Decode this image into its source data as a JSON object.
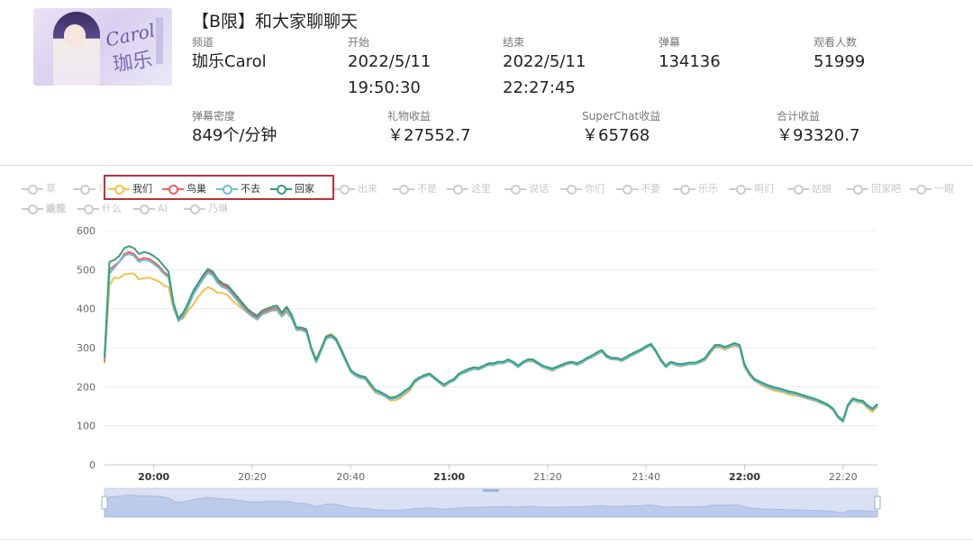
{
  "stream": {
    "title": "【B限】和大家聊聊天",
    "thumbnail": {
      "sig_latin": "Carol",
      "sig_cjk": "珈乐"
    },
    "fields_row1": [
      {
        "label": "频道",
        "value": "珈乐Carol"
      },
      {
        "label": "开始",
        "value": "2022/5/11",
        "value2": "19:50:30"
      },
      {
        "label": "结束",
        "value": "2022/5/11",
        "value2": "22:27:45"
      },
      {
        "label": "弹幕",
        "value": "134136"
      },
      {
        "label": "观看人数",
        "value": "51999"
      }
    ],
    "fields_row2": [
      {
        "label": "弹幕密度",
        "value": "849个/分钟"
      },
      {
        "label": "礼物收益",
        "value": "￥27552.7"
      },
      {
        "label": "SuperChat收益",
        "value": "￥65768"
      },
      {
        "label": "合计收益",
        "value": "￥93320.7"
      }
    ]
  },
  "legend": [
    {
      "name": "草",
      "on": false
    },
    {
      "name": "？",
      "on": false
    },
    {
      "name": "我们",
      "on": true
    },
    {
      "name": "鸟巢",
      "on": true
    },
    {
      "name": "不去",
      "on": true
    },
    {
      "name": "回家",
      "on": true
    },
    {
      "name": "出来",
      "on": false
    },
    {
      "name": "不是",
      "on": false
    },
    {
      "name": "这里",
      "on": false
    },
    {
      "name": "说话",
      "on": false
    },
    {
      "name": "你们",
      "on": false
    },
    {
      "name": "不要",
      "on": false
    },
    {
      "name": "乐乐",
      "on": false
    },
    {
      "name": "啊们",
      "on": false
    },
    {
      "name": "姑娘",
      "on": false
    },
    {
      "name": "回家吧",
      "on": false
    },
    {
      "name": "一眼",
      "on": false
    },
    {
      "name": "运营",
      "on": false
    },
    {
      "name": "什么",
      "on": false
    },
    {
      "name": "AI",
      "on": false
    },
    {
      "name": "乃琳",
      "on": false
    },
    {
      "name": "晚晚",
      "on": false
    }
  ],
  "colors": {
    "我们": "#f2c14e",
    "鸟巢": "#e8625c",
    "不去": "#72b9d8",
    "回家": "#3a9e78",
    "inactive": "#cccccc",
    "highlight_box": "#b8323c"
  },
  "chart_data": {
    "type": "line",
    "xlabel": "",
    "ylabel": "",
    "ylim": [
      0,
      600
    ],
    "yticks": [
      "0",
      "100",
      "200",
      "300",
      "400",
      "500",
      "600"
    ],
    "xticks": [
      {
        "t": 10,
        "label": "20:00",
        "bold": true
      },
      {
        "t": 30,
        "label": "20:20",
        "bold": false
      },
      {
        "t": 50,
        "label": "20:40",
        "bold": false
      },
      {
        "t": 70,
        "label": "21:00",
        "bold": true
      },
      {
        "t": 90,
        "label": "21:20",
        "bold": false
      },
      {
        "t": 110,
        "label": "21:40",
        "bold": false
      },
      {
        "t": 130,
        "label": "22:00",
        "bold": true
      },
      {
        "t": 150,
        "label": "22:20",
        "bold": false
      }
    ],
    "x_minutes_since_1950": [
      0,
      1,
      2,
      3,
      4,
      5,
      6,
      7,
      8,
      9,
      10,
      11,
      12,
      13,
      14,
      15,
      16,
      17,
      18,
      19,
      20,
      21,
      22,
      23,
      24,
      25,
      26,
      27,
      28,
      29,
      30,
      31,
      32,
      33,
      34,
      35,
      36,
      37,
      38,
      39,
      40,
      41,
      42,
      43,
      44,
      45,
      46,
      47,
      48,
      49,
      50,
      51,
      52,
      53,
      54,
      55,
      56,
      57,
      58,
      59,
      60,
      61,
      62,
      63,
      64,
      65,
      66,
      67,
      68,
      69,
      70,
      71,
      72,
      73,
      74,
      75,
      76,
      77,
      78,
      79,
      80,
      81,
      82,
      83,
      84,
      85,
      86,
      87,
      88,
      89,
      90,
      91,
      92,
      93,
      94,
      95,
      96,
      97,
      98,
      99,
      100,
      101,
      102,
      103,
      104,
      105,
      106,
      107,
      108,
      109,
      110,
      111,
      112,
      113,
      114,
      115,
      116,
      117,
      118,
      119,
      120,
      121,
      122,
      123,
      124,
      125,
      126,
      127,
      128,
      129,
      130,
      131,
      132,
      133,
      134,
      135,
      136,
      137,
      138,
      139,
      140,
      141,
      142,
      143,
      144,
      145,
      146,
      147,
      148,
      149,
      150,
      151,
      152,
      153,
      154,
      155,
      156,
      157
    ],
    "series": [
      {
        "name": "我们",
        "values": [
          260,
          460,
          480,
          478,
          488,
          490,
          490,
          475,
          478,
          480,
          475,
          470,
          460,
          455,
          400,
          370,
          375,
          395,
          410,
          430,
          445,
          455,
          450,
          440,
          440,
          435,
          420,
          410,
          400,
          390,
          385,
          375,
          385,
          390,
          395,
          395,
          380,
          390,
          375,
          350,
          350,
          345,
          300,
          270,
          300,
          330,
          335,
          325,
          300,
          270,
          240,
          230,
          225,
          220,
          200,
          185,
          180,
          175,
          165,
          165,
          170,
          180,
          190,
          210,
          220,
          225,
          230,
          220,
          210,
          200,
          210,
          215,
          230,
          235,
          240,
          245,
          245,
          250,
          255,
          255,
          260,
          260,
          265,
          260,
          250,
          260,
          265,
          265,
          258,
          250,
          245,
          240,
          248,
          252,
          258,
          260,
          255,
          262,
          270,
          275,
          282,
          290,
          275,
          270,
          270,
          265,
          272,
          280,
          285,
          292,
          300,
          305,
          288,
          265,
          250,
          260,
          255,
          252,
          255,
          258,
          258,
          262,
          268,
          285,
          300,
          300,
          295,
          300,
          305,
          300,
          250,
          230,
          215,
          208,
          200,
          195,
          190,
          188,
          185,
          180,
          178,
          176,
          172,
          168,
          165,
          160,
          155,
          150,
          140,
          120,
          110,
          150,
          165,
          160,
          158,
          145,
          135,
          150
        ]
      },
      {
        "name": "鸟巢",
        "values": [
          265,
          500,
          510,
          520,
          540,
          545,
          540,
          525,
          530,
          528,
          520,
          510,
          495,
          485,
          410,
          372,
          385,
          410,
          440,
          460,
          480,
          498,
          490,
          470,
          460,
          455,
          440,
          425,
          410,
          395,
          385,
          378,
          390,
          395,
          400,
          402,
          385,
          400,
          380,
          348,
          348,
          343,
          298,
          265,
          295,
          325,
          330,
          320,
          295,
          268,
          240,
          230,
          225,
          222,
          205,
          190,
          185,
          178,
          170,
          172,
          178,
          188,
          196,
          214,
          222,
          228,
          232,
          222,
          212,
          204,
          212,
          218,
          232,
          238,
          244,
          248,
          246,
          252,
          258,
          258,
          262,
          262,
          268,
          262,
          252,
          262,
          268,
          268,
          260,
          252,
          248,
          245,
          250,
          255,
          260,
          262,
          258,
          264,
          272,
          278,
          286,
          292,
          278,
          272,
          272,
          268,
          275,
          282,
          288,
          294,
          302,
          308,
          290,
          268,
          252,
          262,
          258,
          256,
          258,
          260,
          260,
          265,
          272,
          290,
          305,
          305,
          300,
          305,
          310,
          305,
          255,
          232,
          218,
          212,
          205,
          200,
          196,
          194,
          190,
          186,
          184,
          180,
          176,
          172,
          168,
          164,
          158,
          152,
          142,
          122,
          112,
          152,
          168,
          165,
          162,
          150,
          142,
          155
        ]
      },
      {
        "name": "不去",
        "values": [
          270,
          490,
          505,
          520,
          535,
          540,
          535,
          520,
          525,
          523,
          515,
          505,
          490,
          480,
          405,
          368,
          380,
          405,
          435,
          455,
          475,
          492,
          485,
          465,
          455,
          450,
          435,
          420,
          405,
          390,
          380,
          372,
          385,
          390,
          395,
          398,
          380,
          395,
          375,
          345,
          345,
          340,
          295,
          262,
          292,
          322,
          328,
          318,
          292,
          265,
          238,
          228,
          222,
          220,
          203,
          188,
          182,
          176,
          168,
          170,
          175,
          185,
          194,
          212,
          220,
          226,
          230,
          220,
          210,
          202,
          210,
          216,
          230,
          236,
          242,
          246,
          244,
          250,
          256,
          256,
          260,
          260,
          266,
          260,
          250,
          260,
          266,
          266,
          258,
          250,
          246,
          243,
          248,
          253,
          258,
          260,
          256,
          262,
          270,
          276,
          284,
          290,
          276,
          270,
          270,
          266,
          273,
          280,
          286,
          292,
          300,
          306,
          288,
          266,
          250,
          260,
          256,
          254,
          256,
          258,
          258,
          263,
          270,
          288,
          303,
          303,
          298,
          303,
          308,
          303,
          252,
          230,
          216,
          210,
          203,
          198,
          194,
          192,
          188,
          184,
          182,
          178,
          174,
          170,
          166,
          162,
          156,
          150,
          140,
          120,
          110,
          150,
          166,
          162,
          160,
          148,
          140,
          153
        ]
      },
      {
        "name": "回家",
        "values": [
          275,
          520,
          525,
          535,
          555,
          560,
          555,
          540,
          545,
          542,
          535,
          525,
          510,
          495,
          415,
          375,
          390,
          415,
          445,
          465,
          485,
          502,
          495,
          475,
          465,
          460,
          445,
          430,
          415,
          400,
          390,
          382,
          395,
          400,
          405,
          408,
          390,
          405,
          385,
          352,
          352,
          347,
          300,
          268,
          298,
          328,
          333,
          323,
          298,
          270,
          243,
          233,
          228,
          225,
          208,
          192,
          187,
          180,
          172,
          174,
          180,
          190,
          198,
          216,
          224,
          230,
          234,
          224,
          214,
          206,
          214,
          220,
          234,
          240,
          246,
          250,
          248,
          254,
          260,
          260,
          264,
          264,
          270,
          264,
          254,
          264,
          270,
          270,
          262,
          254,
          250,
          247,
          252,
          257,
          262,
          264,
          260,
          266,
          274,
          280,
          288,
          294,
          280,
          274,
          274,
          270,
          277,
          284,
          290,
          296,
          304,
          310,
          292,
          270,
          254,
          264,
          260,
          258,
          260,
          262,
          262,
          267,
          274,
          292,
          307,
          307,
          302,
          307,
          312,
          307,
          258,
          235,
          220,
          214,
          208,
          203,
          199,
          196,
          192,
          188,
          186,
          182,
          178,
          174,
          170,
          166,
          160,
          154,
          144,
          124,
          114,
          154,
          170,
          166,
          164,
          152,
          144,
          156
        ]
      }
    ],
    "grid": true,
    "legend": "top",
    "dataZoom": {
      "range": "full"
    }
  }
}
